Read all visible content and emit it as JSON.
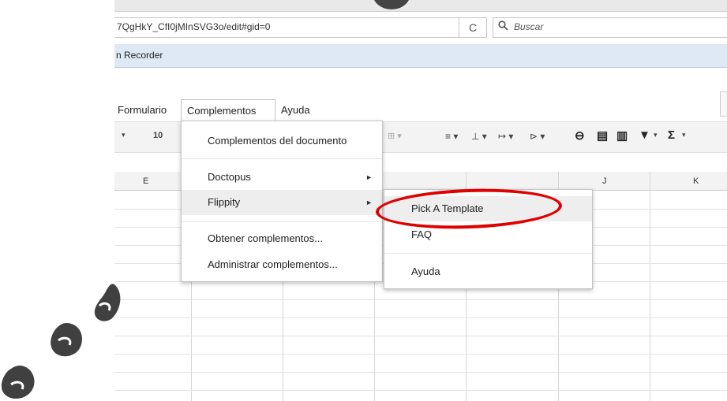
{
  "browser": {
    "url": "7QgHkY_CfI0jMInSVG3o/edit#gid=0",
    "reload_glyph": "C",
    "search_placeholder": "Buscar",
    "bookmark": "n Recorder"
  },
  "menubar": {
    "items": [
      "Formulario",
      "Complementos",
      "Ayuda"
    ]
  },
  "toolbar": {
    "font_size": "10",
    "dropdown_caret": "▾"
  },
  "columns": [
    "E",
    "J",
    "K"
  ],
  "complementos_menu": {
    "items": [
      {
        "label": "Complementos del documento",
        "submenu": false
      },
      {
        "label": "Doctopus",
        "submenu": true
      },
      {
        "label": "Flippity",
        "submenu": true,
        "highlighted": true
      },
      {
        "label": "Obtener complementos...",
        "submenu": false
      },
      {
        "label": "Administrar complementos...",
        "submenu": false
      }
    ]
  },
  "flippity_submenu": {
    "items": [
      "Pick A Template",
      "FAQ",
      "Ayuda"
    ]
  },
  "annotation": {
    "highlight_color": "#e00000",
    "circled_item": "Pick A Template"
  }
}
